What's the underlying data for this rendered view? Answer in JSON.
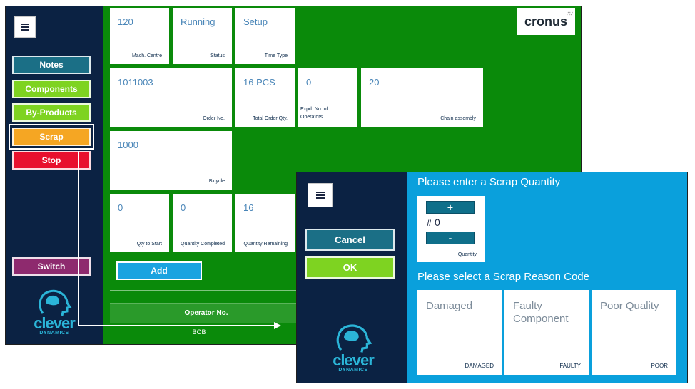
{
  "main": {
    "sidebar": {
      "buttons": [
        {
          "label": "Notes",
          "color": "#1b6f86"
        },
        {
          "label": "Components",
          "color": "#7ed321"
        },
        {
          "label": "By-Products",
          "color": "#7ed321"
        },
        {
          "label": "Scrap",
          "color": "#f5a623"
        },
        {
          "label": "Stop",
          "color": "#e8102e"
        }
      ],
      "switch_label": "Switch",
      "switch_color": "#8e2a6e",
      "logo": {
        "word": "clever",
        "sub": "DYNAMICS"
      }
    },
    "brand": "cronus",
    "tiles": [
      {
        "value": "120",
        "caption": "Mach. Centre"
      },
      {
        "value": "Running",
        "caption": "Status"
      },
      {
        "value": "Setup",
        "caption": "Time Type"
      },
      {
        "value": "1011003",
        "caption": "Order No."
      },
      {
        "value": "16 PCS",
        "caption": "Total Order Qty."
      },
      {
        "value": "0",
        "caption": "Expd. No. of Operators"
      },
      {
        "value": "20",
        "caption": "Chain assembly"
      },
      {
        "value": "1000",
        "caption": "Bicycle"
      },
      {
        "value": "0",
        "caption": "Qty to Start"
      },
      {
        "value": "0",
        "caption": "Quantity Completed"
      },
      {
        "value": "16",
        "caption": "Quantity Remaining"
      }
    ],
    "add_label": "Add",
    "operator_header": "Operator No.",
    "operator_value": "BOB"
  },
  "dialog": {
    "sidebar": {
      "cancel_label": "Cancel",
      "cancel_color": "#1b6f86",
      "ok_label": "OK",
      "ok_color": "#7ed321",
      "logo": {
        "word": "clever",
        "sub": "DYNAMICS"
      }
    },
    "qty_title": "Please enter a Scrap Quantity",
    "plus_label": "+",
    "minus_label": "-",
    "qty_hash": "#",
    "qty_value": "0",
    "qty_caption": "Quantity",
    "reason_title": "Please select a Scrap Reason Code",
    "reasons": [
      {
        "name": "Damaged",
        "code": "DAMAGED"
      },
      {
        "name": "Faulty Component",
        "code": "FAULTY"
      },
      {
        "name": "Poor Quality",
        "code": "POOR"
      }
    ]
  },
  "colors": {
    "main_bg": "#0a8a0a",
    "dialog_bg": "#0aa0dc",
    "sidebar_bg": "#0b2243"
  }
}
